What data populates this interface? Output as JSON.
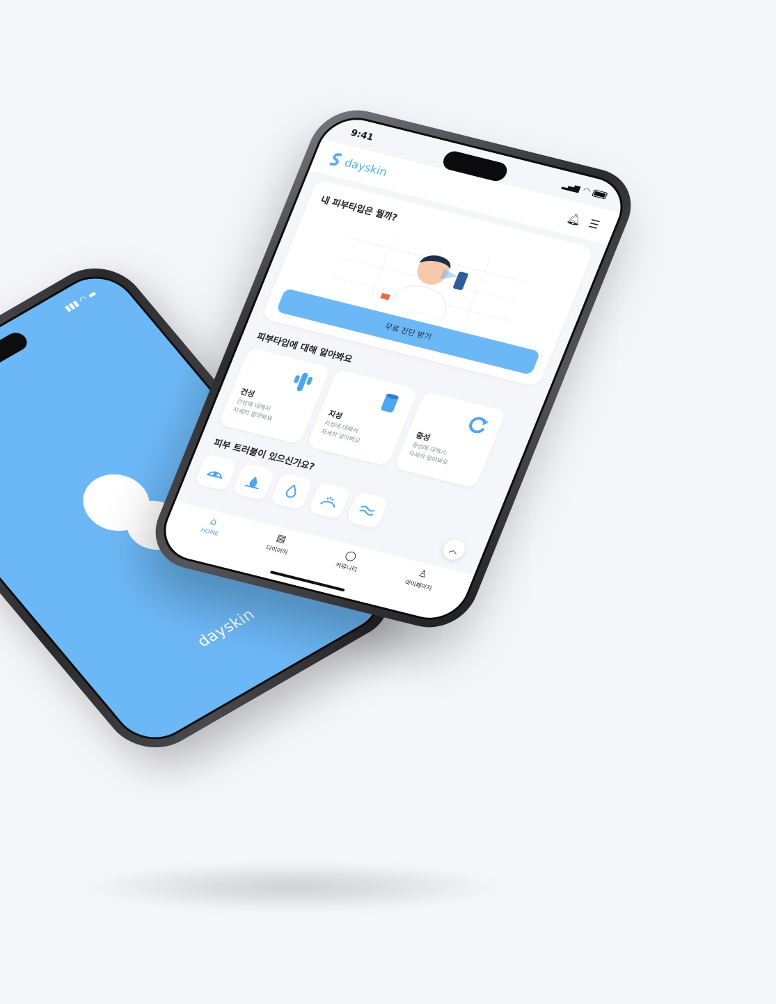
{
  "colors": {
    "accent": "#6cb8f6",
    "brand_text": "#5aaef4",
    "background": "#f5f6fa"
  },
  "splash": {
    "wordmark": "dayskin"
  },
  "status_bar": {
    "time": "9:41"
  },
  "header": {
    "brand": "dayskin",
    "icons": [
      "bell-icon",
      "menu-icon"
    ]
  },
  "hero": {
    "title": "내 피부타입은 뭘까?",
    "cta_label": "무료 진단 받기"
  },
  "skin_types": {
    "title": "피부타입에 대해 알아봐요",
    "items": [
      {
        "name": "건성",
        "desc": "건성에 대해서\n자세히 알아봐요",
        "icon": "cactus-icon"
      },
      {
        "name": "지성",
        "desc": "지성에 대해서\n자세히 알아봐요",
        "icon": "oil-can-icon"
      },
      {
        "name": "중성",
        "desc": "중성에 대해서\n자세히 알아봐요",
        "icon": "refresh-icon"
      }
    ]
  },
  "troubles": {
    "title": "피부 트러블이 있으신가요?",
    "icons": [
      "sensitive-icon",
      "drop-icon",
      "oil-drop-icon",
      "irritation-icon",
      "wave-icon"
    ]
  },
  "tabs": [
    {
      "label": "HOME",
      "icon": "home-icon",
      "active": true
    },
    {
      "label": "다이어리",
      "icon": "diary-icon",
      "active": false
    },
    {
      "label": "커뮤니티",
      "icon": "chat-icon",
      "active": false
    },
    {
      "label": "마이페이지",
      "icon": "user-icon",
      "active": false
    }
  ]
}
